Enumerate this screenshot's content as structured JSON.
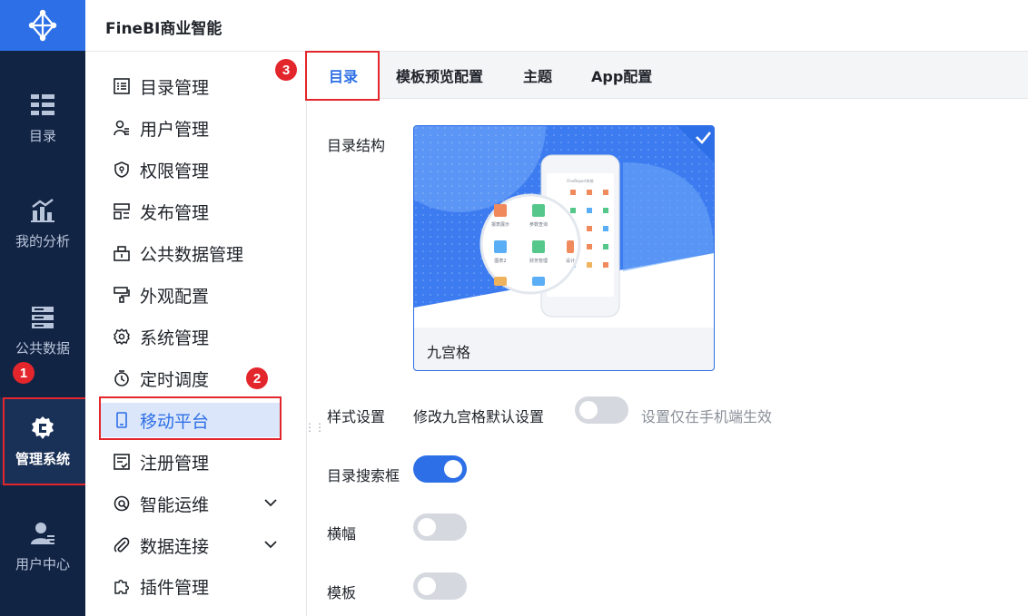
{
  "app": {
    "title": "FineBI商业智能"
  },
  "leftnav": {
    "items": [
      {
        "label": "目录",
        "icon": "catalog-icon"
      },
      {
        "label": "我的分析",
        "icon": "analysis-icon"
      },
      {
        "label": "公共数据",
        "icon": "public-data-icon"
      },
      {
        "label": "管理系统",
        "icon": "management-gear-icon",
        "active": true
      },
      {
        "label": "用户中心",
        "icon": "user-center-icon"
      }
    ]
  },
  "submenu": {
    "items": [
      {
        "label": "目录管理",
        "icon": "list-icon"
      },
      {
        "label": "用户管理",
        "icon": "user-icon"
      },
      {
        "label": "权限管理",
        "icon": "shield-icon"
      },
      {
        "label": "发布管理",
        "icon": "publish-icon"
      },
      {
        "label": "公共数据管理",
        "icon": "data-icon"
      },
      {
        "label": "外观配置",
        "icon": "brush-icon"
      },
      {
        "label": "系统管理",
        "icon": "gear-icon"
      },
      {
        "label": "定时调度",
        "icon": "timer-icon"
      },
      {
        "label": "移动平台",
        "icon": "mobile-icon",
        "active": true
      },
      {
        "label": "注册管理",
        "icon": "register-icon"
      },
      {
        "label": "智能运维",
        "icon": "ops-icon",
        "expandable": true
      },
      {
        "label": "数据连接",
        "icon": "link-icon",
        "expandable": true
      },
      {
        "label": "插件管理",
        "icon": "plugin-icon"
      }
    ]
  },
  "tabs": [
    {
      "label": "目录",
      "active": true
    },
    {
      "label": "模板预览配置"
    },
    {
      "label": "主题"
    },
    {
      "label": "App配置"
    }
  ],
  "annotations": {
    "badge1": "1",
    "badge2": "2",
    "badge3": "3"
  },
  "content": {
    "catalog_structure_label": "目录结构",
    "card_label": "九宫格",
    "style_label": "样式设置",
    "style_sub_label": "修改九宫格默认设置",
    "style_hint": "设置仅在手机端生效",
    "search_label": "目录搜索框",
    "banner_label": "横幅",
    "template_label": "模板",
    "toggles": {
      "style_default": false,
      "search_box": true,
      "banner": false,
      "template": false
    }
  },
  "preview": {
    "phone_title": "FineReport系统",
    "tiles": [
      "报表展示",
      "参数查询",
      "图表2",
      "财务管理",
      "设计"
    ]
  },
  "colors": {
    "accent": "#2d6fe6",
    "nav_bg": "#122444",
    "annotation_red": "#e3262c"
  }
}
